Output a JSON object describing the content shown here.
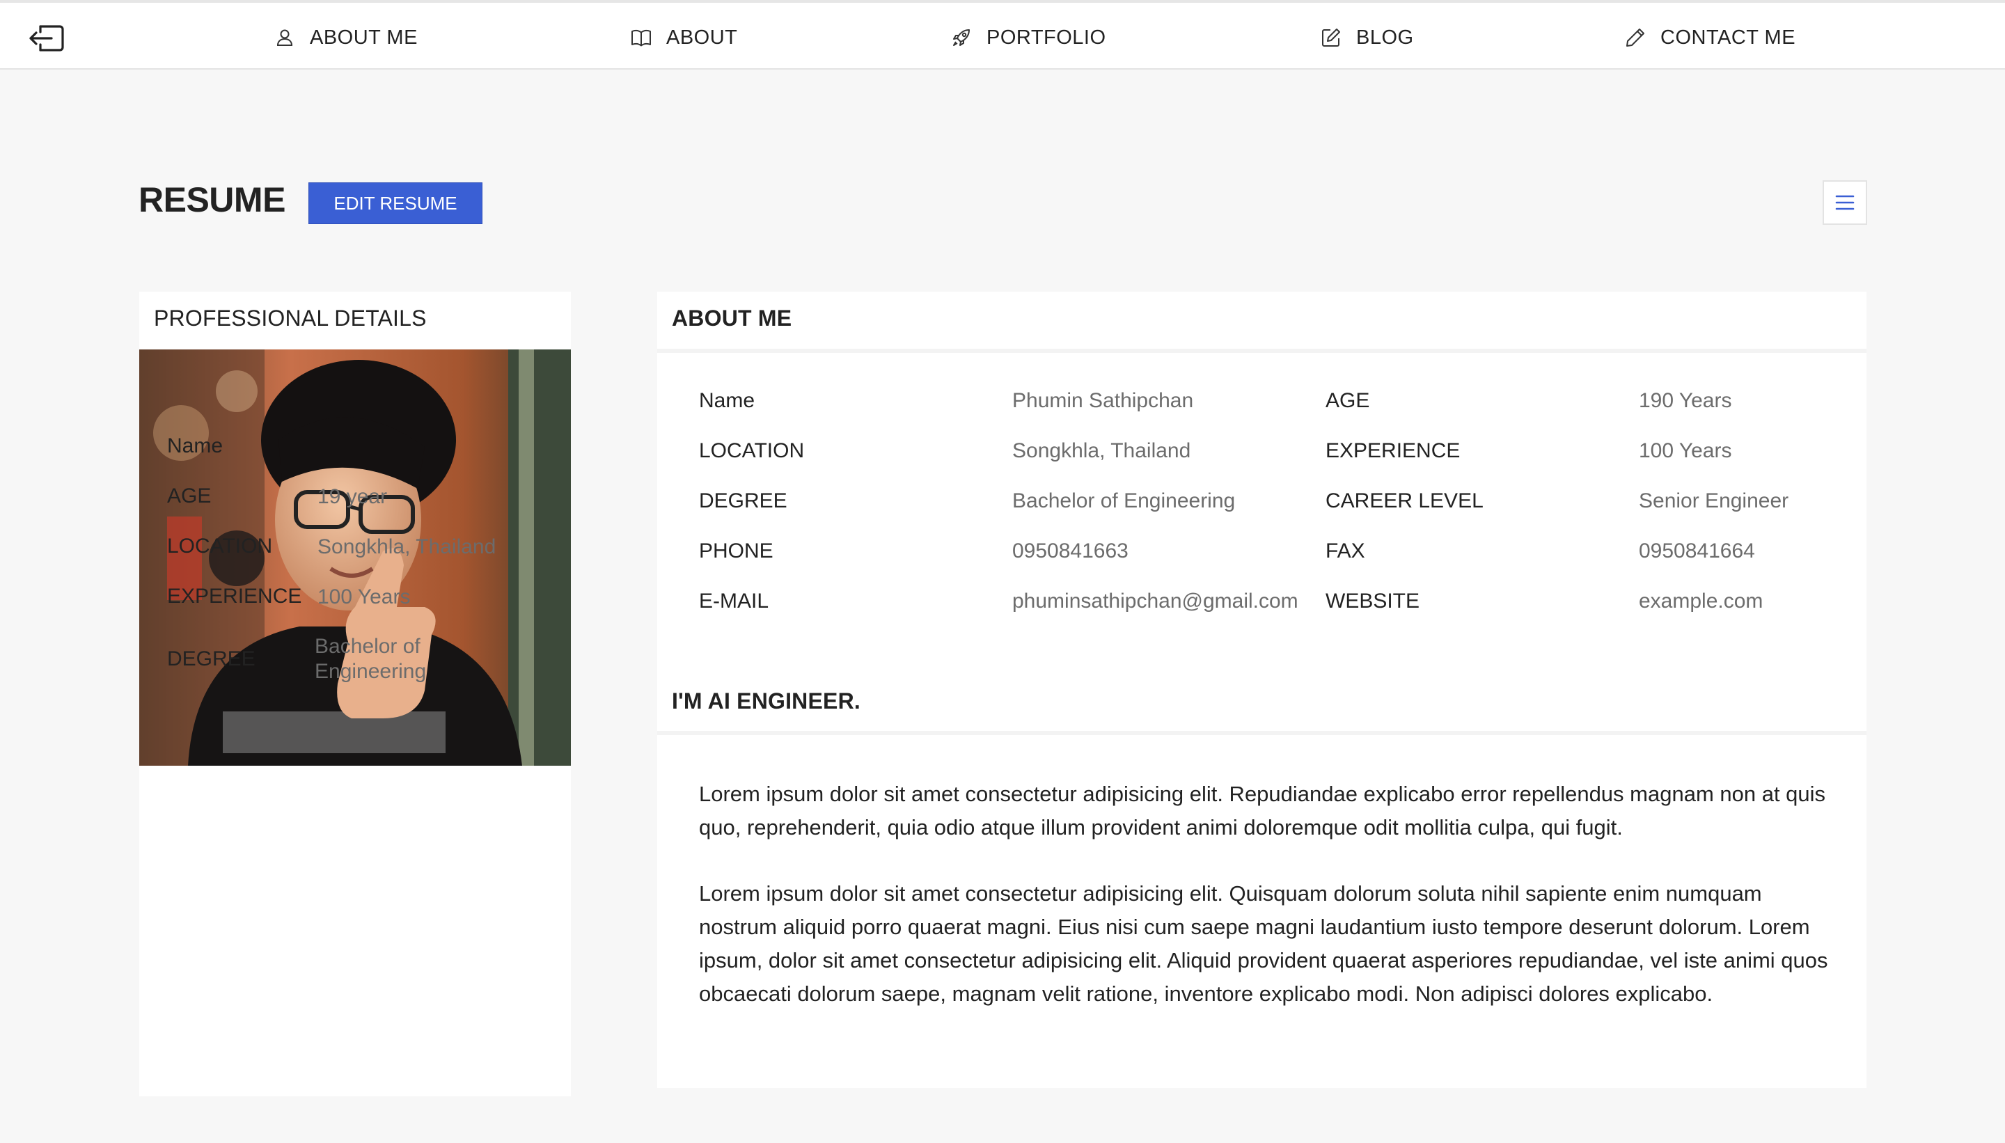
{
  "nav": {
    "items": [
      {
        "label": "ABOUT ME",
        "icon": "user-icon"
      },
      {
        "label": "ABOUT",
        "icon": "book-icon"
      },
      {
        "label": "PORTFOLIO",
        "icon": "rocket-icon"
      },
      {
        "label": "BLOG",
        "icon": "edit-icon"
      },
      {
        "label": "CONTACT ME",
        "icon": "pencil-icon"
      }
    ]
  },
  "header": {
    "title": "RESUME",
    "edit_label": "EDIT RESUME"
  },
  "professional": {
    "title": "PROFESSIONAL DETAILS",
    "rows": [
      {
        "label": "Name",
        "value": ""
      },
      {
        "label": "AGE",
        "value": "19 year"
      },
      {
        "label": "LOCATION",
        "value": "Songkhla, Thailand"
      },
      {
        "label": "EXPERIENCE",
        "value": "100 Years"
      },
      {
        "label": "DEGREE",
        "value_line1": "Bachelor of",
        "value_line2": "Engineering"
      }
    ]
  },
  "about": {
    "title": "ABOUT ME",
    "left": [
      {
        "label": "Name",
        "value": "Phumin Sathipchan"
      },
      {
        "label": "LOCATION",
        "value": "Songkhla, Thailand"
      },
      {
        "label": "DEGREE",
        "value": "Bachelor of Engineering"
      },
      {
        "label": "PHONE",
        "value": "0950841663"
      },
      {
        "label": "E-MAIL",
        "value": "phuminsathipchan@gmail.com"
      }
    ],
    "right": [
      {
        "label": "AGE",
        "value": "190 Years"
      },
      {
        "label": "EXPERIENCE",
        "value": "100 Years"
      },
      {
        "label": "CAREER LEVEL",
        "value": "Senior Engineer"
      },
      {
        "label": "FAX",
        "value": "0950841664"
      },
      {
        "label": "WEBSITE",
        "value": "example.com"
      }
    ]
  },
  "bio": {
    "title": "I'M AI ENGINEER.",
    "p1": "Lorem ipsum dolor sit amet consectetur adipisicing elit. Repudiandae explicabo error repellendus magnam non at quis quo, reprehenderit, quia odio atque illum provident animi doloremque odit mollitia culpa, qui fugit.",
    "p2": "Lorem ipsum dolor sit amet consectetur adipisicing elit. Quisquam dolorum soluta nihil sapiente enim numquam nostrum aliquid porro quaerat magni. Eius nisi cum saepe magni laudantium iusto tempore deserunt dolorum. Lorem ipsum, dolor sit amet consectetur adipisicing elit. Aliquid provident quaerat asperiores repudiandae, vel iste animi quos obcaecati dolorum saepe, magnam velit ratione, inventore explicabo modi. Non adipisci dolores explicabo."
  },
  "colors": {
    "accent": "#3a5fd4",
    "page_bg": "#f7f7f7",
    "card_bg": "#ffffff",
    "muted_text": "#6c6c6c"
  }
}
